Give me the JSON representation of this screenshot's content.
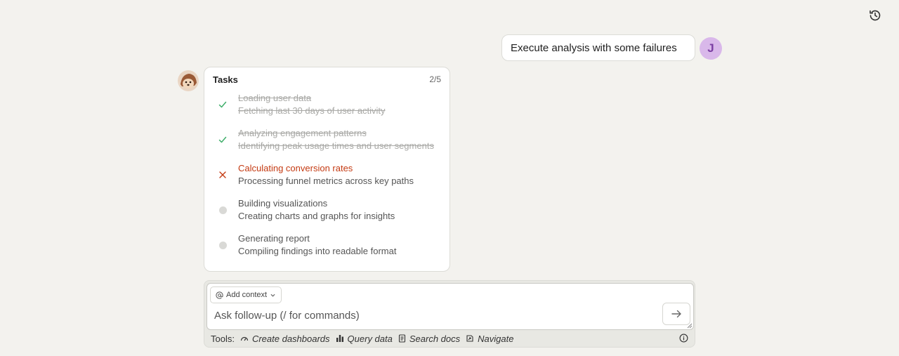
{
  "header": {
    "history_icon": "history-icon"
  },
  "conversation": {
    "user_message": "Execute analysis with some failures",
    "user_initial": "J"
  },
  "tasks": {
    "title": "Tasks",
    "count": "2/5",
    "items": [
      {
        "title": "Loading user data",
        "description": "Fetching last 30 days of user activity",
        "status": "done"
      },
      {
        "title": "Analyzing engagement patterns",
        "description": "Identifying peak usage times and user segments",
        "status": "done"
      },
      {
        "title": "Calculating conversion rates",
        "description": "Processing funnel metrics across key paths",
        "status": "failed"
      },
      {
        "title": "Building visualizations",
        "description": "Creating charts and graphs for insights",
        "status": "pending"
      },
      {
        "title": "Generating report",
        "description": "Compiling findings into readable format",
        "status": "pending"
      }
    ]
  },
  "composer": {
    "add_context_label": "Add context",
    "placeholder": "Ask follow-up (/ for commands)",
    "tools_label": "Tools:",
    "tools": [
      {
        "label": "Create dashboards",
        "icon": "dashboard-gauge-icon"
      },
      {
        "label": "Query data",
        "icon": "bar-chart-icon"
      },
      {
        "label": "Search docs",
        "icon": "document-icon"
      },
      {
        "label": "Navigate",
        "icon": "navigate-page-icon"
      }
    ]
  },
  "colors": {
    "failed": "#c43a12",
    "done_check": "#3fae6a",
    "avatar_bg": "#d9b8ea"
  }
}
